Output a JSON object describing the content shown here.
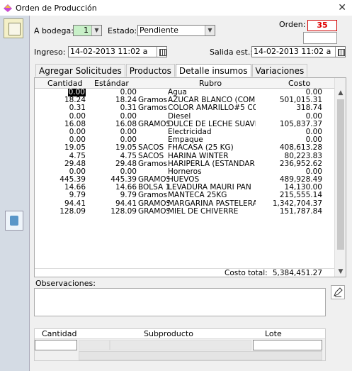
{
  "window": {
    "title": "Orden de Producción",
    "close_glyph": "✕"
  },
  "form": {
    "bodega_label": "A bodega:",
    "bodega_value": "1",
    "estado_label": "Estado:",
    "estado_value": "Pendiente",
    "orden_label": "Orden:",
    "orden_value": "35",
    "ingreso_label": "Ingreso:",
    "ingreso_value": "14-02-2013 11:02 a",
    "salida_label": "Salida est.:",
    "salida_value": "14-02-2013 11:02 a"
  },
  "tabs": [
    {
      "label": "Agregar Solicitudes",
      "active": false
    },
    {
      "label": "Productos",
      "active": false
    },
    {
      "label": "Detalle insumos",
      "active": true
    },
    {
      "label": "Variaciones",
      "active": false
    }
  ],
  "grid": {
    "columns": {
      "cantidad": "Cantidad",
      "estandar": "Estándar",
      "rubro": "Rubro",
      "costo": "Costo"
    },
    "rows": [
      {
        "cantidad": "0.00",
        "estandar": "0.00",
        "unidad": "",
        "rubro": "Agua",
        "costo": "0.00"
      },
      {
        "cantidad": "18.24",
        "estandar": "18.24",
        "unidad": "Gramos S",
        "rubro": "AZUCAR BLANCO (COMER",
        "costo": "501,015.31"
      },
      {
        "cantidad": "0.31",
        "estandar": "0.31",
        "unidad": "Gramos c",
        "rubro": "COLOR AMARILLO#5 CON",
        "costo": "318.74"
      },
      {
        "cantidad": "0.00",
        "estandar": "0.00",
        "unidad": "",
        "rubro": "Diesel",
        "costo": "0.00"
      },
      {
        "cantidad": "16.08",
        "estandar": "16.08",
        "unidad": "GRAMOS",
        "rubro": "DULCE DE LECHE SUAVE F",
        "costo": "105,837.37"
      },
      {
        "cantidad": "0.00",
        "estandar": "0.00",
        "unidad": "",
        "rubro": "Electricidad",
        "costo": "0.00"
      },
      {
        "cantidad": "0.00",
        "estandar": "0.00",
        "unidad": "",
        "rubro": "Empaque",
        "costo": "0.00"
      },
      {
        "cantidad": "19.05",
        "estandar": "19.05",
        "unidad": "SACOS",
        "rubro": "FHACASA (25 KG)",
        "costo": "408,613.28"
      },
      {
        "cantidad": "4.75",
        "estandar": "4.75",
        "unidad": "SACOS",
        "rubro": "HARINA WINTER",
        "costo": "80,223.83"
      },
      {
        "cantidad": "29.48",
        "estandar": "29.48",
        "unidad": "Gramos S",
        "rubro": "HARIPERLA (ESTANDAR /",
        "costo": "236,952.62"
      },
      {
        "cantidad": "0.00",
        "estandar": "0.00",
        "unidad": "",
        "rubro": "Horneros",
        "costo": "0.00"
      },
      {
        "cantidad": "445.39",
        "estandar": "445.39",
        "unidad": "GRAMOS",
        "rubro": "HUEVOS",
        "costo": "489,928.49"
      },
      {
        "cantidad": "14.66",
        "estandar": "14.66",
        "unidad": "BOLSA 1I",
        "rubro": "LEVADURA MAURI PAN",
        "costo": "14,130.00"
      },
      {
        "cantidad": "9.79",
        "estandar": "9.79",
        "unidad": "Gramos (",
        "rubro": "MANTECA 25KG",
        "costo": "215,555.14"
      },
      {
        "cantidad": "94.41",
        "estandar": "94.41",
        "unidad": "GRAMOS",
        "rubro": "MARGARINA PASTELERA R",
        "costo": "1,342,704.37"
      },
      {
        "cantidad": "128.09",
        "estandar": "128.09",
        "unidad": "GRAMOS",
        "rubro": "MIEL DE CHIVERRE",
        "costo": "151,787.84"
      }
    ],
    "total_label": "Costo total:",
    "total_value": "5,384,451.27"
  },
  "observaciones": {
    "label": "Observaciones:",
    "value": ""
  },
  "subproducto": {
    "columns": {
      "cantidad": "Cantidad",
      "subproducto": "Subproducto",
      "lote": "Lote"
    }
  },
  "colors": {
    "orden_value": "#e00000",
    "bodega_field": "#c8f0c8",
    "sidebar": "#d4dbe4",
    "selected_cell": "#000000"
  }
}
